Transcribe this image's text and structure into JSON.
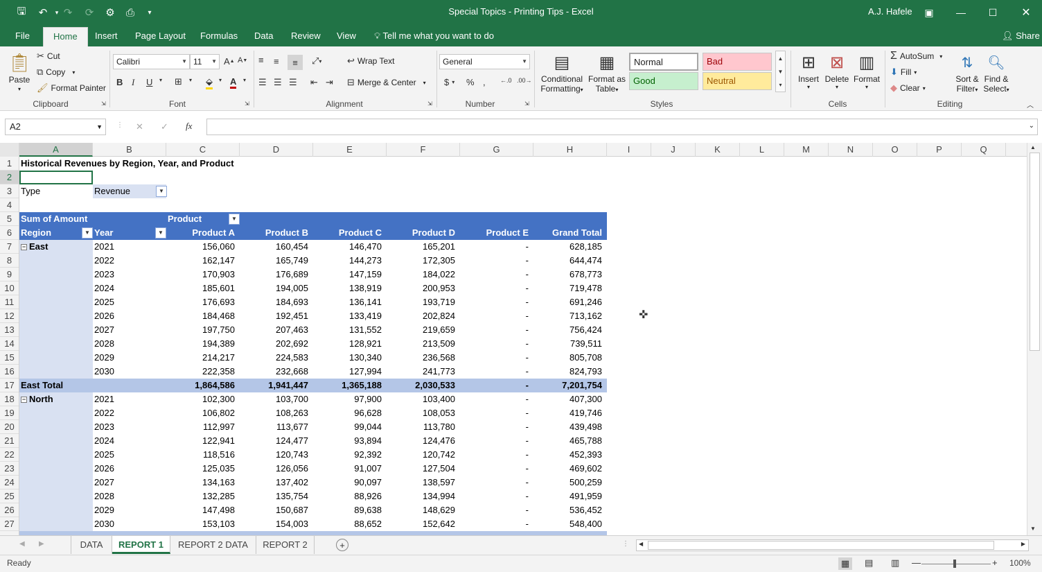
{
  "window": {
    "doc_title": "Special Topics - Printing Tips  -  Excel",
    "user": "A.J. Hafele",
    "accent": "#217346"
  },
  "quick_access": [
    "save-icon",
    "undo-icon",
    "redo-icon",
    "refresh-icon",
    "workbook-icon",
    "print-preview-icon",
    "customize-icon"
  ],
  "ribbon_tabs": [
    {
      "label": "File"
    },
    {
      "label": "Home"
    },
    {
      "label": "Insert"
    },
    {
      "label": "Page Layout"
    },
    {
      "label": "Formulas"
    },
    {
      "label": "Data"
    },
    {
      "label": "Review"
    },
    {
      "label": "View"
    }
  ],
  "tell_me": "Tell me what you want to do",
  "share": "Share",
  "ribbon": {
    "clipboard": {
      "label": "Clipboard",
      "paste": "Paste",
      "cut": "Cut",
      "copy": "Copy",
      "format_painter": "Format Painter"
    },
    "font": {
      "label": "Font",
      "name": "Calibri",
      "size": "11"
    },
    "alignment": {
      "label": "Alignment",
      "wrap": "Wrap Text",
      "merge": "Merge & Center"
    },
    "number": {
      "label": "Number",
      "format": "General"
    },
    "styles": {
      "label": "Styles",
      "conditional": "Conditional",
      "formatting": "Formatting",
      "format_as": "Format as",
      "table": "Table",
      "normal": "Normal",
      "bad": "Bad",
      "good": "Good",
      "neutral": "Neutral"
    },
    "cells": {
      "label": "Cells",
      "insert": "Insert",
      "delete": "Delete",
      "format": "Format"
    },
    "editing": {
      "label": "Editing",
      "autosum": "AutoSum",
      "fill": "Fill",
      "clear": "Clear",
      "sort1": "Sort &",
      "sort2": "Filter",
      "find1": "Find &",
      "find2": "Select"
    }
  },
  "formula_bar": {
    "name_box": "A2",
    "content": ""
  },
  "columns": [
    "A",
    "B",
    "C",
    "D",
    "E",
    "F",
    "G",
    "H",
    "I",
    "J",
    "K",
    "L",
    "M",
    "N",
    "O",
    "P",
    "Q"
  ],
  "rows": [
    "1",
    "2",
    "3",
    "4",
    "5",
    "6",
    "7",
    "8",
    "9",
    "10",
    "11",
    "12",
    "13",
    "14",
    "15",
    "16",
    "17",
    "18",
    "19",
    "20",
    "21",
    "22",
    "23",
    "24",
    "25",
    "26",
    "27"
  ],
  "sheet": {
    "title": "Historical Revenues by Region, Year, and Product",
    "filter_label": "Type",
    "filter_value": "Revenue",
    "sum_label": "Sum of Amount",
    "product_label": "Product",
    "region_label": "Region",
    "year_label": "Year",
    "col_headers": [
      "Product A",
      "Product B",
      "Product C",
      "Product D",
      "Product E",
      "Grand Total"
    ],
    "east": {
      "name": "East",
      "rows": [
        [
          "2021",
          "156,060",
          "160,454",
          "146,470",
          "165,201",
          "-",
          "628,185"
        ],
        [
          "2022",
          "162,147",
          "165,749",
          "144,273",
          "172,305",
          "-",
          "644,474"
        ],
        [
          "2023",
          "170,903",
          "176,689",
          "147,159",
          "184,022",
          "-",
          "678,773"
        ],
        [
          "2024",
          "185,601",
          "194,005",
          "138,919",
          "200,953",
          "-",
          "719,478"
        ],
        [
          "2025",
          "176,693",
          "184,693",
          "136,141",
          "193,719",
          "-",
          "691,246"
        ],
        [
          "2026",
          "184,468",
          "192,451",
          "133,419",
          "202,824",
          "-",
          "713,162"
        ],
        [
          "2027",
          "197,750",
          "207,463",
          "131,552",
          "219,659",
          "-",
          "756,424"
        ],
        [
          "2028",
          "194,389",
          "202,692",
          "128,921",
          "213,509",
          "-",
          "739,511"
        ],
        [
          "2029",
          "214,217",
          "224,583",
          "130,340",
          "236,568",
          "-",
          "805,708"
        ],
        [
          "2030",
          "222,358",
          "232,668",
          "127,994",
          "241,773",
          "-",
          "824,793"
        ]
      ],
      "total_label": "East Total",
      "total": [
        "1,864,586",
        "1,941,447",
        "1,365,188",
        "2,030,533",
        "-",
        "7,201,754"
      ]
    },
    "north": {
      "name": "North",
      "rows": [
        [
          "2021",
          "102,300",
          "103,700",
          "97,900",
          "103,400",
          "-",
          "407,300"
        ],
        [
          "2022",
          "106,802",
          "108,263",
          "96,628",
          "108,053",
          "-",
          "419,746"
        ],
        [
          "2023",
          "112,997",
          "113,677",
          "99,044",
          "113,780",
          "-",
          "439,498"
        ],
        [
          "2024",
          "122,941",
          "124,477",
          "93,894",
          "124,476",
          "-",
          "465,788"
        ],
        [
          "2025",
          "118,516",
          "120,743",
          "92,392",
          "120,742",
          "-",
          "452,393"
        ],
        [
          "2026",
          "125,035",
          "126,056",
          "91,007",
          "127,504",
          "-",
          "469,602"
        ],
        [
          "2027",
          "134,163",
          "137,402",
          "90,097",
          "138,597",
          "-",
          "500,259"
        ],
        [
          "2028",
          "132,285",
          "135,754",
          "88,926",
          "134,994",
          "-",
          "491,959"
        ],
        [
          "2029",
          "147,498",
          "150,687",
          "89,638",
          "148,629",
          "-",
          "536,452"
        ],
        [
          "2030",
          "153,103",
          "154,003",
          "88,652",
          "152,642",
          "-",
          "548,400"
        ]
      ]
    }
  },
  "sheet_tabs": [
    "DATA",
    "REPORT 1",
    "REPORT 2 DATA",
    "REPORT 2"
  ],
  "active_sheet": "REPORT 1",
  "status": {
    "mode": "Ready",
    "zoom": "100%"
  }
}
